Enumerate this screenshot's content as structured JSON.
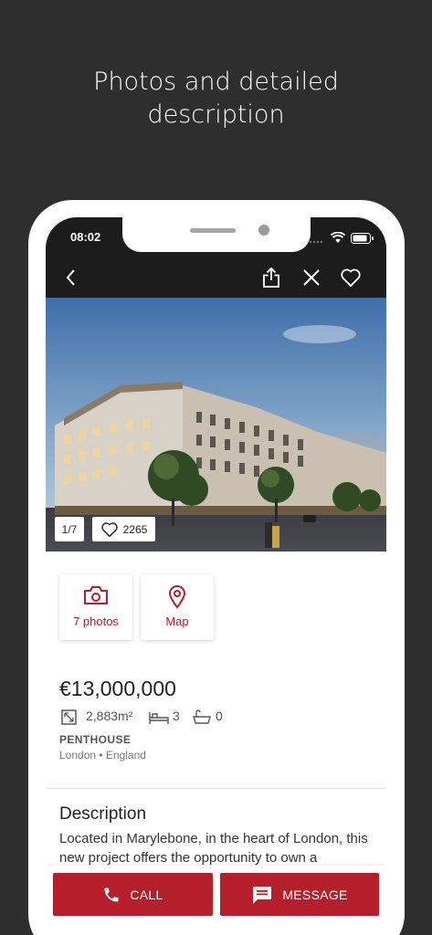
{
  "headline": {
    "line1": "Photos and detailed",
    "line2": "description"
  },
  "status_bar": {
    "time": "08:02"
  },
  "gallery": {
    "counter": "1/7",
    "likes": "2265"
  },
  "quick_actions": {
    "photos_label": "7 photos",
    "map_label": "Map"
  },
  "listing": {
    "price": "€13,000,000",
    "area": "2,883m²",
    "bedrooms": "3",
    "bathrooms": "0",
    "property_type": "PENTHOUSE",
    "location": "London • England"
  },
  "description": {
    "title": "Description",
    "text": "Located in Marylebone, in the heart of London, this new project offers the opportunity to own a"
  },
  "actions": {
    "call_label": "CALL",
    "message_label": "MESSAGE"
  },
  "colors": {
    "accent": "#b51f2b",
    "background": "#2e2e2e",
    "topbar": "#1c1c1c"
  }
}
